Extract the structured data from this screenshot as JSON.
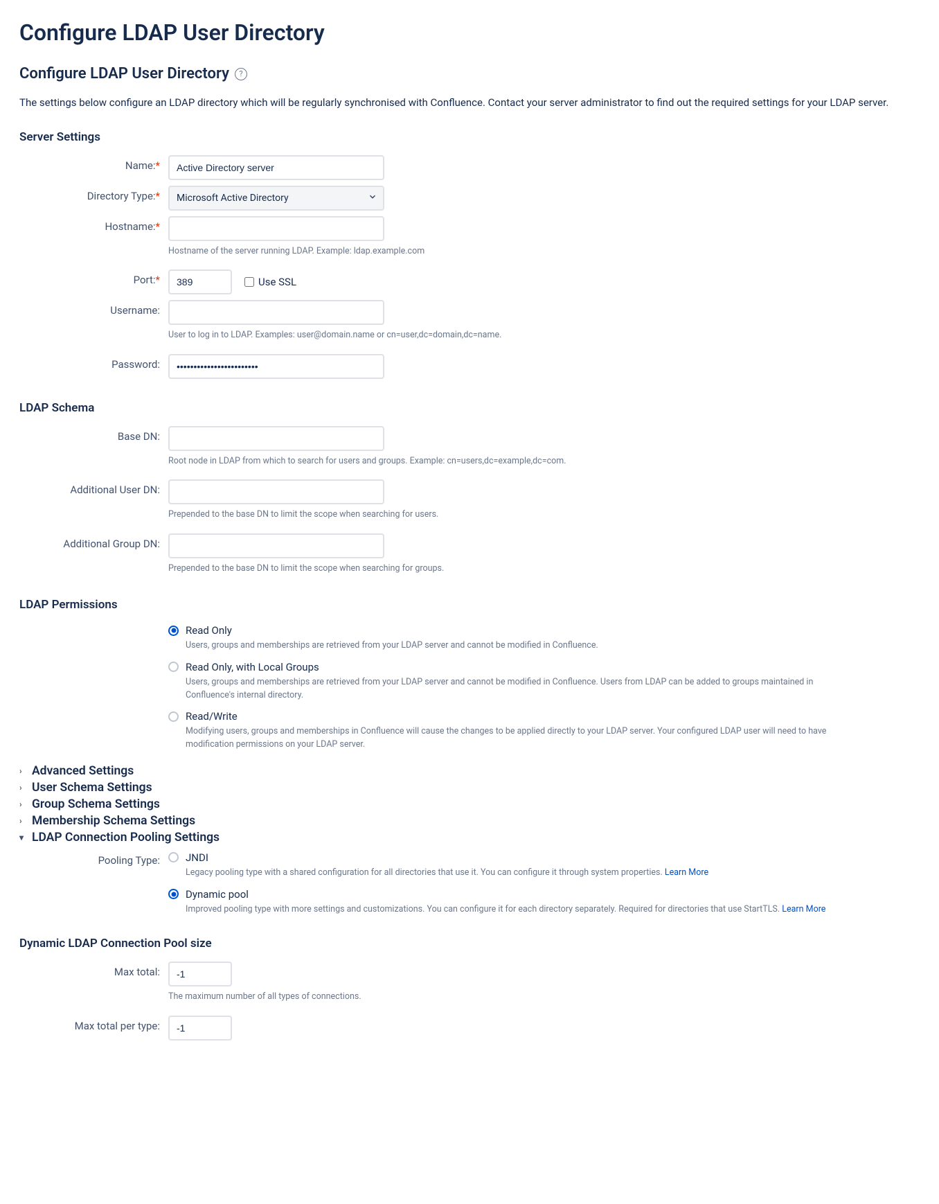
{
  "pageTitle": "Configure LDAP User Directory",
  "subTitle": "Configure LDAP User Directory",
  "intro": "The settings below configure an LDAP directory which will be regularly synchronised with Confluence. Contact your server administrator to find out the required settings for your LDAP server.",
  "serverSettings": {
    "heading": "Server Settings",
    "name": {
      "label": "Name:",
      "value": "Active Directory server"
    },
    "directoryType": {
      "label": "Directory Type:",
      "value": "Microsoft Active Directory"
    },
    "hostname": {
      "label": "Hostname:",
      "value": "",
      "hint": "Hostname of the server running LDAP. Example: ldap.example.com"
    },
    "port": {
      "label": "Port:",
      "value": "389",
      "useSslLabel": "Use SSL"
    },
    "username": {
      "label": "Username:",
      "value": "",
      "hint": "User to log in to LDAP. Examples: user@domain.name or cn=user,dc=domain,dc=name."
    },
    "password": {
      "label": "Password:",
      "value": "••••••••••••••••••••••••"
    }
  },
  "ldapSchema": {
    "heading": "LDAP Schema",
    "baseDn": {
      "label": "Base DN:",
      "value": "",
      "hint": "Root node in LDAP from which to search for users and groups. Example: cn=users,dc=example,dc=com."
    },
    "addUserDn": {
      "label": "Additional User DN:",
      "value": "",
      "hint": "Prepended to the base DN to limit the scope when searching for users."
    },
    "addGroupDn": {
      "label": "Additional Group DN:",
      "value": "",
      "hint": "Prepended to the base DN to limit the scope when searching for groups."
    }
  },
  "ldapPermissions": {
    "heading": "LDAP Permissions",
    "options": [
      {
        "label": "Read Only",
        "desc": "Users, groups and memberships are retrieved from your LDAP server and cannot be modified in Confluence.",
        "checked": true
      },
      {
        "label": "Read Only, with Local Groups",
        "desc": "Users, groups and memberships are retrieved from your LDAP server and cannot be modified in Confluence. Users from LDAP can be added to groups maintained in Confluence's internal directory.",
        "checked": false
      },
      {
        "label": "Read/Write",
        "desc": "Modifying users, groups and memberships in Confluence will cause the changes to be applied directly to your LDAP server. Your configured LDAP user will need to have modification permissions on your LDAP server.",
        "checked": false
      }
    ]
  },
  "expanders": [
    {
      "label": "Advanced Settings",
      "open": false
    },
    {
      "label": "User Schema Settings",
      "open": false
    },
    {
      "label": "Group Schema Settings",
      "open": false
    },
    {
      "label": "Membership Schema Settings",
      "open": false
    },
    {
      "label": "LDAP Connection Pooling Settings",
      "open": true
    }
  ],
  "poolingType": {
    "label": "Pooling Type:",
    "options": [
      {
        "label": "JNDI",
        "desc": "Legacy pooling type with a shared configuration for all directories that use it. You can configure it through system properties. ",
        "link": "Learn More",
        "checked": false
      },
      {
        "label": "Dynamic pool",
        "desc": "Improved pooling type with more settings and customizations. You can configure it for each directory separately. Required for directories that use StartTLS. ",
        "link": "Learn More",
        "checked": true
      }
    ]
  },
  "poolSize": {
    "heading": "Dynamic LDAP Connection Pool size",
    "maxTotal": {
      "label": "Max total:",
      "value": "-1",
      "hint": "The maximum number of all types of connections."
    },
    "maxTotalPerType": {
      "label": "Max total per type:",
      "value": "-1"
    }
  }
}
